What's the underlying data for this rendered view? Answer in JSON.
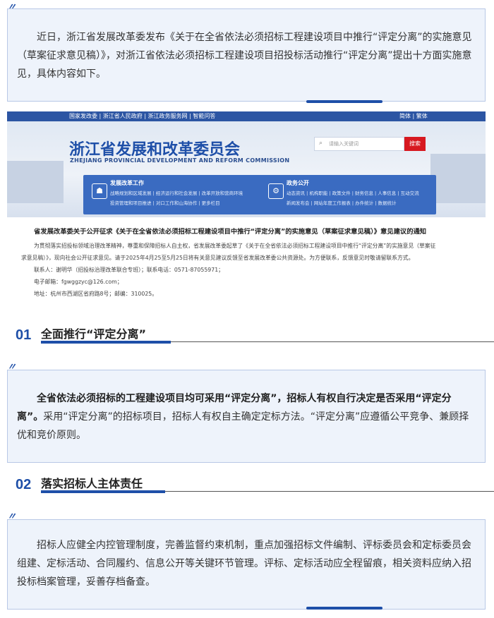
{
  "intro": {
    "text": "近日，浙江省发展改革委发布《关于在全省依法必须招标工程建设项目中推行“评定分离”的实施意见（草案征求意见稿）》，对浙江省依法必须招标工程建设项目招投标活动推行“评定分离”提出十方面实施意见，具体内容如下。"
  },
  "screenshot": {
    "topbar_left": "国家发改委 | 浙江省人民政府 | 浙江政务服务网 | 智能问答",
    "topbar_right": "简体 | 繁体",
    "site_title": "浙江省发展和改革委员会",
    "site_title_en": "ZHEJIANG PROVINCIAL DEVELOPMENT AND REFORM COMMISSION",
    "search_placeholder": "请输入关键词",
    "search_button": "搜索",
    "nav_left_title": "发展改革工作",
    "nav_left_row1": "战略规划和区域发展 | 经济运行和社会发展 | 改革开放和营商环境",
    "nav_left_row2": "投资管理和项目推进 | 对口工作和山海协作 | 更多栏目",
    "nav_right_title": "政务公开",
    "nav_right_row1": "动态资讯 | 机构职能 | 政策文件 | 财务信息 | 人事信息 | 互动交流",
    "nav_right_row2": "新闻发布会 | 网站年度工作报表 | 办件统计 | 数据统计",
    "notice_title": "省发展改革委关于公开征求《关于在全省依法必须招标工程建设项目中推行“评定分离”的实施意见（草案征求意见稿）》意见建议的通知",
    "notice_body1": "为贯彻落实招投标领域治理改革精神，尊重和保障招标人自主权，省发展改革委起草了《关于在全省依法必须招标工程建设项目中推行“评定分离”的实施意见（草案征",
    "notice_body2": "求意见稿）》，现向社会公开征求意见。请于2025年4月25至5月25日将有关意见建议反馈至省发展改革委公共资源处。为方便联系，反馈意见时敬请留联系方式。",
    "contact": "联系人：谢明华（招投标治理改革联合专班）；联系电话：0571-87055971；",
    "email": "电子邮箱：fgwggzyc@126.com；",
    "address": "地址：杭州市西湖区省府路8号；邮编：310025。"
  },
  "sections": [
    {
      "number": "01",
      "title": "全面推行“评定分离”",
      "lead": "全省依法必须招标的工程建设项目均可采用“评定分离”，招标人有权自行决定是否采用“评定分离”。",
      "body": "采用“评定分离”的招标项目，招标人有权自主确定定标方法。“评定分离”应遵循公平竞争、兼顾择优和竞价原则。"
    },
    {
      "number": "02",
      "title": "落实招标人主体责任",
      "lead": "",
      "body": "招标人应健全内控管理制度，完善监督约束机制，重点加强招标文件编制、评标委员会和定标委员会组建、定标活动、合同履约、信息公开等关键环节管理。评标、定标活动应全程留痕，相关资料应纳入招投标档案管理，妥善存档备查。"
    }
  ],
  "colors": {
    "accent": "#1e4fa8",
    "box_bg": "#eef3fb",
    "search_button": "#d71920"
  }
}
